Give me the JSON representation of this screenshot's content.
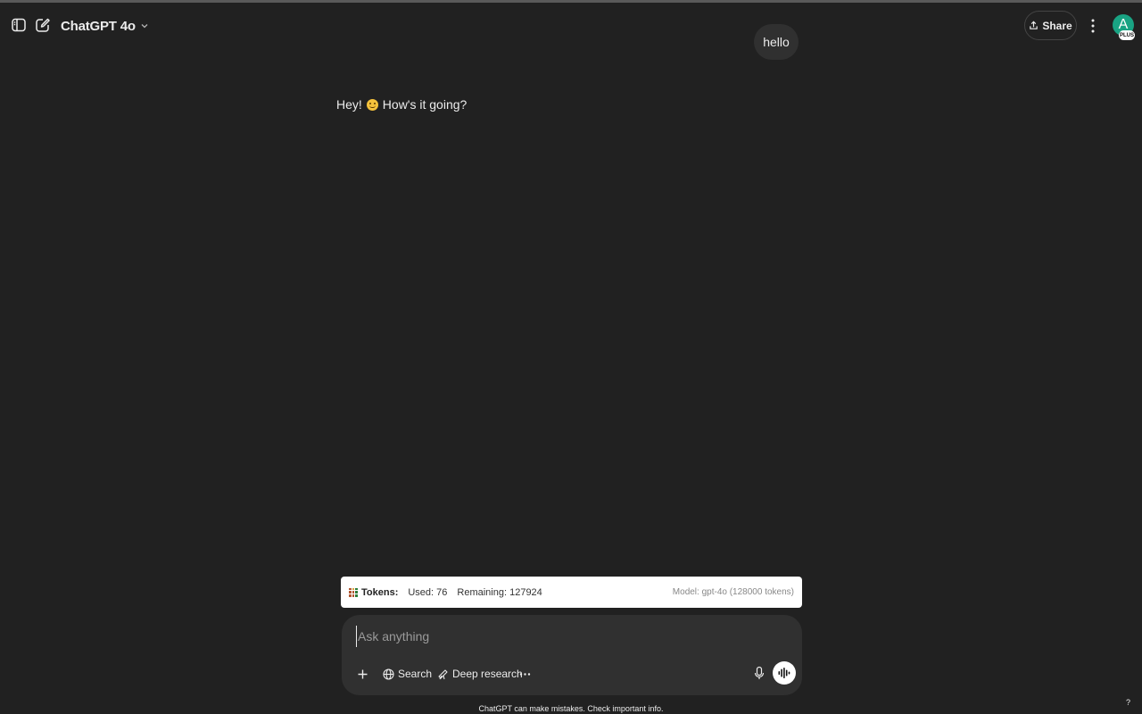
{
  "header": {
    "model_name": "ChatGPT 4o",
    "share_label": "Share",
    "avatar_letter": "A",
    "plan_badge": "PLUS",
    "icons": {
      "sidebar": "sidebar-toggle-icon",
      "new_chat": "new-chat-icon",
      "model_dropdown": "chevron-down-icon",
      "share": "share-icon",
      "more": "more-vertical-icon"
    }
  },
  "conversation": {
    "user_message": "hello",
    "assistant_greeting": "Hey!",
    "assistant_emoji": "smiling-face-emoji",
    "assistant_text": "How's it going?"
  },
  "tokens": {
    "label": "Tokens:",
    "used": "Used: 76",
    "remaining": "Remaining: 127924",
    "model": "Model: gpt-4o (128000 tokens)"
  },
  "composer": {
    "placeholder": "Ask anything",
    "value": "",
    "tools": {
      "search_label": "Search",
      "deep_research_label": "Deep research"
    },
    "icons": {
      "add": "plus-icon",
      "search": "globe-icon",
      "deep_research": "telescope-icon",
      "more": "more-horizontal-icon",
      "mic": "microphone-icon",
      "voice": "voice-mode-icon"
    }
  },
  "footer": {
    "disclaimer": "ChatGPT can make mistakes. Check important info.",
    "help_label": "?"
  },
  "colors": {
    "background": "#212121",
    "surface": "#303030",
    "text": "#ececec",
    "avatar": "#19a383",
    "tokens_bar": "#ffffff"
  }
}
